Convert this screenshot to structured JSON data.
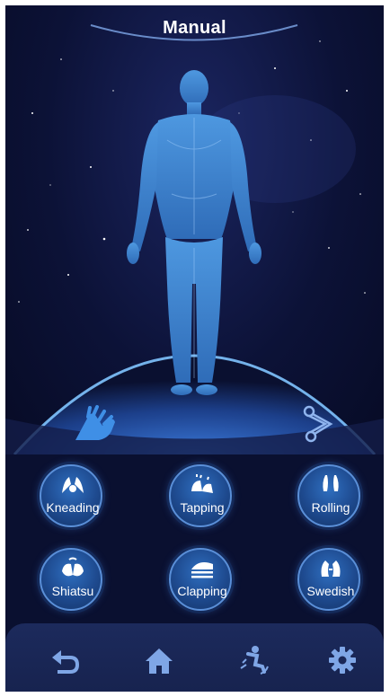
{
  "header": {
    "title": "Manual"
  },
  "hero": {
    "left_icon": "hand-massage-icon",
    "right_icon": "route-track-icon"
  },
  "modes": [
    {
      "label": "Kneading",
      "icon": "kneading-hands-icon"
    },
    {
      "label": "Tapping",
      "icon": "tapping-hands-icon"
    },
    {
      "label": "Rolling",
      "icon": "rolling-hands-icon"
    },
    {
      "label": "Shiatsu",
      "icon": "shiatsu-hands-icon"
    },
    {
      "label": "Clapping",
      "icon": "clapping-hands-icon"
    },
    {
      "label": "Swedish",
      "icon": "swedish-hands-icon"
    }
  ],
  "tabbar": {
    "items": [
      "back-icon",
      "home-icon",
      "leg-massage-icon",
      "settings-gear-icon"
    ]
  },
  "colors": {
    "background": "#0a1030",
    "accent_blue": "#3f8fe6",
    "button_border": "#5a8fd8",
    "tabbar": "#1c2a5c",
    "icon_color": "#7fa6e6"
  }
}
